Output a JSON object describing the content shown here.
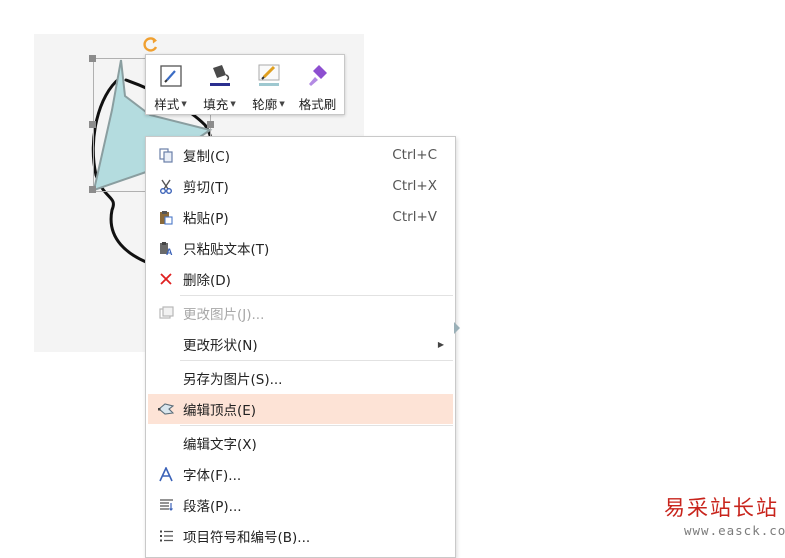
{
  "mini_toolbar": {
    "buttons": [
      {
        "label": "样式",
        "icon": "style-icon",
        "has_dropdown": true
      },
      {
        "label": "填充",
        "icon": "fill-bucket-icon",
        "has_dropdown": true
      },
      {
        "label": "轮廓",
        "icon": "outline-pen-icon",
        "has_dropdown": true
      },
      {
        "label": "格式刷",
        "icon": "format-painter-icon",
        "has_dropdown": false
      }
    ]
  },
  "context_menu": {
    "items": [
      {
        "label": "复制(C)",
        "shortcut": "Ctrl+C",
        "icon": "copy-icon"
      },
      {
        "label": "剪切(T)",
        "shortcut": "Ctrl+X",
        "icon": "scissors-icon"
      },
      {
        "label": "粘贴(P)",
        "shortcut": "Ctrl+V",
        "icon": "paste-icon"
      },
      {
        "label": "只粘贴文本(T)",
        "icon": "paste-text-icon"
      },
      {
        "label": "删除(D)",
        "icon": "delete-x-icon"
      },
      {
        "label": "更改图片(J)...",
        "icon": "change-picture-icon",
        "disabled": true
      },
      {
        "label": "更改形状(N)",
        "has_submenu": true
      },
      {
        "label": "另存为图片(S)..."
      },
      {
        "label": "编辑顶点(E)",
        "icon": "edit-points-icon",
        "highlighted": true
      },
      {
        "label": "编辑文字(X)"
      },
      {
        "label": "字体(F)...",
        "icon": "font-icon"
      },
      {
        "label": "段落(P)...",
        "icon": "paragraph-icon"
      },
      {
        "label": "项目符号和编号(B)...",
        "icon": "bullets-icon"
      }
    ]
  },
  "watermark": {
    "site_name": "易采站长站",
    "url": "www.easck.com"
  },
  "colors": {
    "highlight": "#fde3d6",
    "shape_fill": "#b4dcdf",
    "rotate_handle": "#f0a030",
    "delete_red": "#e02020",
    "watermark_red": "#c8241c"
  }
}
